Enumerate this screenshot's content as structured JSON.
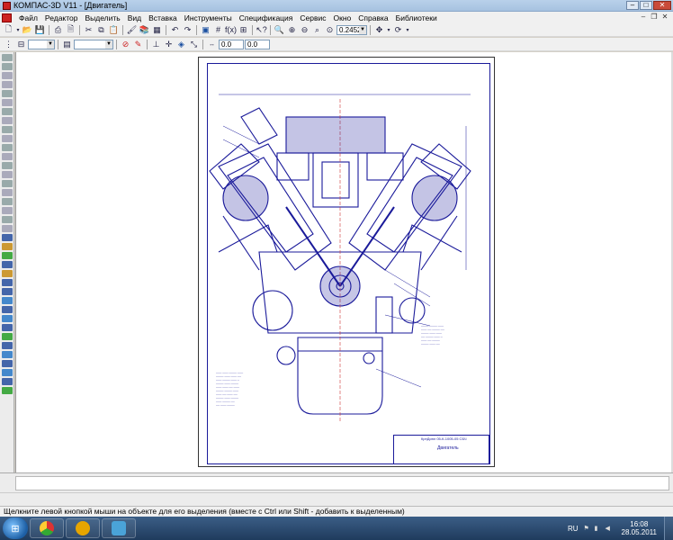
{
  "window": {
    "title": "КОМПАС-3D V11 - [Двигатель]"
  },
  "menu": {
    "items": [
      "Файл",
      "Редактор",
      "Выделить",
      "Вид",
      "Вставка",
      "Инструменты",
      "Спецификация",
      "Сервис",
      "Окно",
      "Справка",
      "Библиотеки"
    ]
  },
  "toolbar_standard": {
    "zoom_value": "0.2452"
  },
  "toolbar_props": {
    "coord1": "0.0",
    "coord2": "0.0"
  },
  "drawing": {
    "stamp_title": "Двигатель",
    "stamp_code": "КрнДипл 05-К-1005-05 СБЧ",
    "accent_color": "#1a1a9a"
  },
  "status": {
    "hint": "Щелкните левой кнопкой мыши на объекте для его выделения (вместе с Ctrl или Shift - добавить к выделенным)"
  },
  "taskbar": {
    "apps": [
      "chrome-icon",
      "autocad-icon",
      "kompas-icon"
    ],
    "lang": "RU",
    "time": "16:08",
    "date": "28.05.2011"
  }
}
